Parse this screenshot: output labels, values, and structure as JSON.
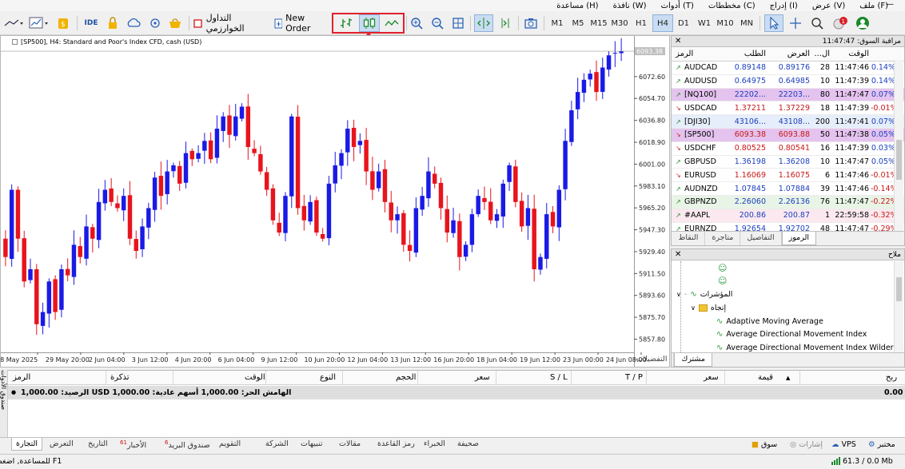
{
  "menu": [
    "ملف (F)",
    "عرض (V)",
    "إدراج (I)",
    "مخططات (C)",
    "أدوات (T)",
    "نافذة (W)",
    "مساعدة (H)"
  ],
  "toolbar": {
    "ide_label": "IDE",
    "algo_label": "التداول الخوارزمي",
    "new_order_label": "New Order",
    "timeframes": [
      "M1",
      "M5",
      "M15",
      "M30",
      "H1",
      "H4",
      "D1",
      "W1",
      "MN"
    ],
    "timeframe_labels": [
      "M1",
      "M5",
      "M15",
      "M30",
      "H1",
      "H4",
      "D1",
      "W1",
      "M10",
      "MN"
    ],
    "active_timeframe": "H4",
    "notifications_count": "1"
  },
  "chart": {
    "title": "[SP500], H4:  Standard and Poor's Index CFD, cash (USD)",
    "current_price": "6093.38"
  },
  "chart_data": {
    "type": "candlestick",
    "price_labels": [
      "6093.38",
      "6072.60",
      "6054.70",
      "6036.80",
      "6018.90",
      "6001.00",
      "5983.10",
      "5965.20",
      "5947.30",
      "5929.40",
      "5911.50",
      "5893.60",
      "5875.70",
      "5857.80"
    ],
    "y_ticks": [
      6072.6,
      6054.7,
      6036.8,
      6018.9,
      6001.0,
      5983.1,
      5965.2,
      5947.3,
      5929.4,
      5911.5,
      5893.6,
      5875.7,
      5857.8
    ],
    "ylim": [
      5847,
      6098
    ],
    "x_labels": [
      "28 May 2025",
      "29 May 20:00",
      "2 Jun 04:00",
      "3 Jun 12:00",
      "4 Jun 20:00",
      "6 Jun 04:00",
      "9 Jun 12:00",
      "10 Jun 20:00",
      "12 Jun 04:00",
      "13 Jun 12:00",
      "16 Jun 20:00",
      "18 Jun 04:00",
      "19 Jun 12:00",
      "23 Jun 00:00",
      "24 Jun 08:00"
    ],
    "close_path": [
      5925,
      5980,
      5940,
      5905,
      5915,
      5870,
      5880,
      5905,
      5880,
      5915,
      5910,
      5935,
      5925,
      5950,
      5940,
      5970,
      5980,
      5970,
      5965,
      5975,
      5940,
      5930,
      5950,
      5965,
      5990,
      5975,
      5995,
      6000,
      5985,
      6010,
      6005,
      6010,
      6020,
      6005,
      6030,
      6040,
      6025,
      6040,
      6048,
      6015,
      6010,
      5995,
      5980,
      5955,
      5945,
      5975,
      6040,
      5965,
      5955,
      5970,
      5945,
      5940,
      5985,
      6000,
      6010,
      6030,
      6015,
      6020,
      5995,
      5980,
      5995,
      5970,
      5955,
      5960,
      5935,
      5930,
      5965,
      5975,
      5995,
      5985,
      5965,
      5945,
      5955,
      5925,
      5935,
      5960,
      5975,
      5970,
      5955,
      5960,
      5985,
      6000,
      5970,
      5950,
      5965,
      5915,
      5925,
      5960,
      5950,
      5980,
      6020,
      6045,
      6060,
      6070,
      6075,
      6060,
      6080,
      6090,
      6092,
      6093.38
    ]
  },
  "market_watch": {
    "title": "مراقبة السوق: 11:47:47",
    "headers": {
      "symbol": "الرمز",
      "bid": "الطلب",
      "ask": "العرض",
      "spread": "...ال",
      "time": "الوقت",
      "change": ""
    },
    "rows": [
      {
        "symbol": "AUDCAD",
        "bid": "0.89148",
        "ask": "0.89176",
        "spread": "28",
        "time": "11:47:46",
        "change": "0.14%",
        "dir": "up",
        "hl": ""
      },
      {
        "symbol": "AUDUSD",
        "bid": "0.64975",
        "ask": "0.64985",
        "spread": "10",
        "time": "11:47:39",
        "change": "0.14%",
        "dir": "up",
        "hl": ""
      },
      {
        "symbol": "[NQ100]",
        "bid": "22202...",
        "ask": "22203...",
        "spread": "80",
        "time": "11:47:47",
        "change": "0.07%",
        "dir": "up",
        "hl": "purple"
      },
      {
        "symbol": "USDCAD",
        "bid": "1.37211",
        "ask": "1.37229",
        "spread": "18",
        "time": "11:47:39",
        "change": "-0.01%",
        "dir": "dn",
        "hl": ""
      },
      {
        "symbol": "[DJI30]",
        "bid": "43106...",
        "ask": "43108...",
        "spread": "200",
        "time": "11:47:41",
        "change": "0.07%",
        "dir": "up",
        "hl": "blue"
      },
      {
        "symbol": "[SP500]",
        "bid": "6093.38",
        "ask": "6093.88",
        "spread": "50",
        "time": "11:47:38",
        "change": "0.05%",
        "dir": "dn",
        "hl": "purple"
      },
      {
        "symbol": "USDCHF",
        "bid": "0.80525",
        "ask": "0.80541",
        "spread": "16",
        "time": "11:47:39",
        "change": "0.03%",
        "dir": "dn",
        "hl": ""
      },
      {
        "symbol": "GBPUSD",
        "bid": "1.36198",
        "ask": "1.36208",
        "spread": "10",
        "time": "11:47:47",
        "change": "0.05%",
        "dir": "up",
        "hl": ""
      },
      {
        "symbol": "EURUSD",
        "bid": "1.16069",
        "ask": "1.16075",
        "spread": "6",
        "time": "11:47:46",
        "change": "-0.01%",
        "dir": "dn",
        "hl": ""
      },
      {
        "symbol": "AUDNZD",
        "bid": "1.07845",
        "ask": "1.07884",
        "spread": "39",
        "time": "11:47:46",
        "change": "-0.14%",
        "dir": "up",
        "hl": ""
      },
      {
        "symbol": "GBPNZD",
        "bid": "2.26060",
        "ask": "2.26136",
        "spread": "76",
        "time": "11:47:47",
        "change": "-0.22%",
        "dir": "up",
        "hl": "green"
      },
      {
        "symbol": "#AAPL",
        "bid": "200.86",
        "ask": "200.87",
        "spread": "1",
        "time": "22:59:58",
        "change": "-0.32%",
        "dir": "up",
        "hl": "pink"
      },
      {
        "symbol": "EURNZD",
        "bid": "1.92654",
        "ask": "1.92702",
        "spread": "48",
        "time": "11:47:47",
        "change": "-0.29%",
        "dir": "up",
        "hl": ""
      }
    ],
    "tabs": [
      "الرموز",
      "التفاصيل",
      "متاجرة",
      "النقاط"
    ],
    "active_tab": "الرموز"
  },
  "navigator": {
    "title": "ملاح",
    "indicators_label": "المؤشرات",
    "trend_label": "إتجاه",
    "items": [
      "Adaptive Moving Average",
      "Average Directional Movement Index",
      "Average Directional Movement Index Wilder"
    ],
    "tabs": [
      "مشترك",
      "التفضيلات"
    ],
    "active_tab": "مشترك"
  },
  "toolbox": {
    "headers": {
      "symbol": "الرمز",
      "ticket": "تذكرة",
      "time": "الوقت",
      "type": "النوع",
      "volume": "الحجم",
      "price": "سعر",
      "sl": "S / L",
      "tp": "T / P",
      "price2": "سعر",
      "value": "قيمة",
      "profit": "ربح"
    },
    "balance_text": "الرصيد: 1,000.00 USD  الهامش الحر: 1,000.00  أسهم عادية: 1,000.00",
    "profit_value": "0.00",
    "side_label": "صندوق الأدوات",
    "tabs": [
      "التجارة",
      "التعرض",
      "التاريخ",
      "الأخبار",
      "صندوق البريد",
      "التقويم",
      "الشركة",
      "تنبيهات",
      "مقالات",
      "رمز القاعدة",
      "الخبراء",
      "صحيفة"
    ],
    "news_count": "61",
    "mail_count": "6",
    "active_tab": "التجارة",
    "right_tools": {
      "market": "سوق",
      "signals": "إشارات",
      "vps": "VPS",
      "tester": "مختبر"
    }
  },
  "status": {
    "help": "للمساعدة, اضغط F1",
    "traffic": "61.3 / 0.0 Mb"
  },
  "colors": {
    "bull": "#1a1ae6",
    "bear": "#e8141c",
    "highlight": "#e0212a",
    "active_tf": "#c9dcf2"
  }
}
